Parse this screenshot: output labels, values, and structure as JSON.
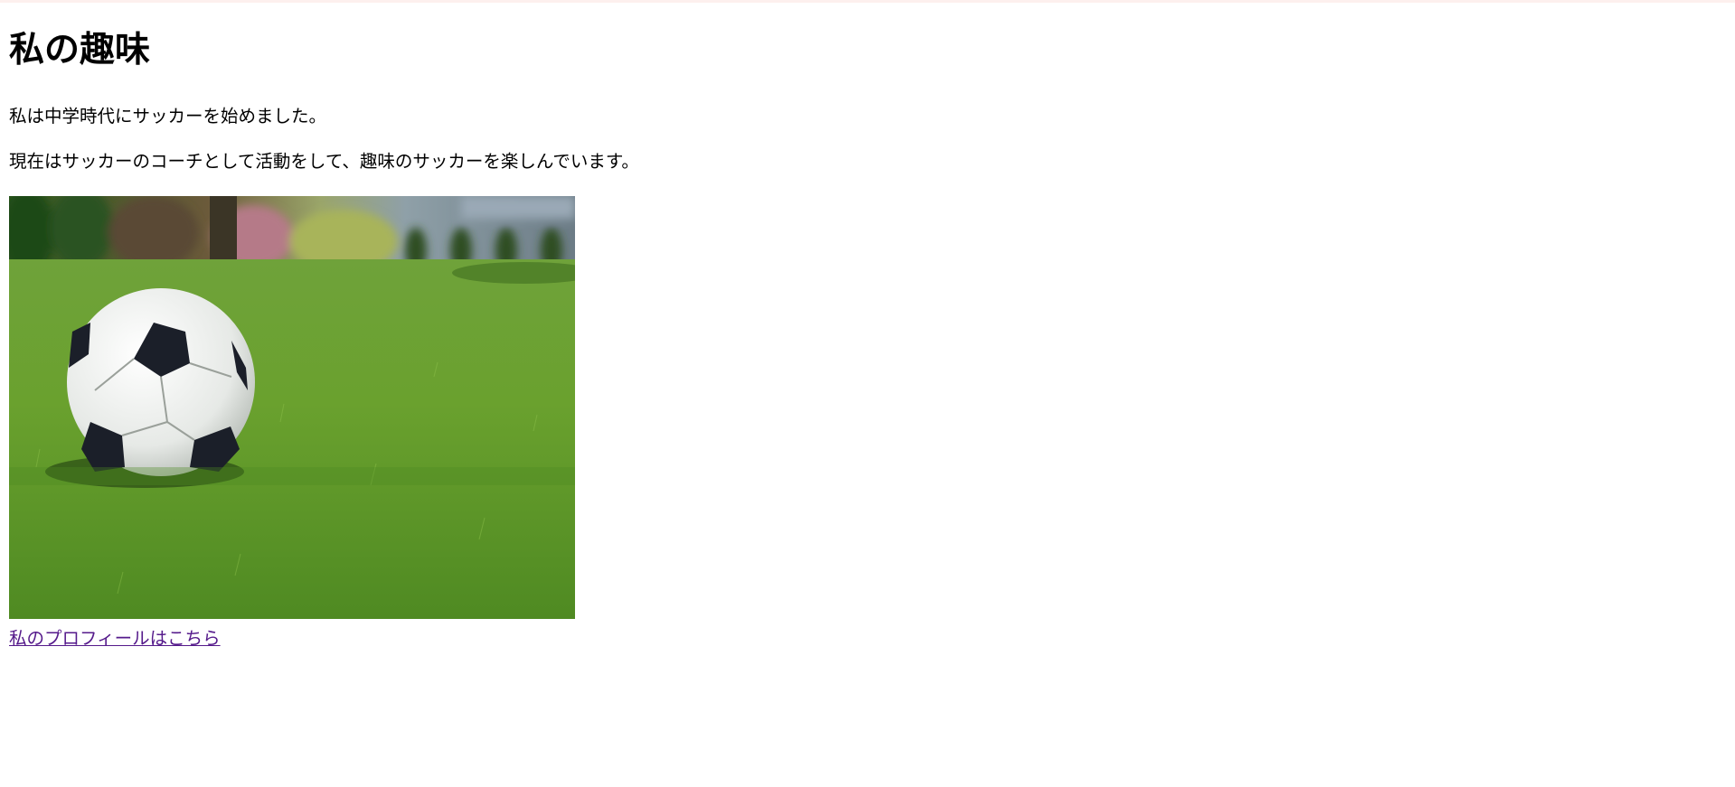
{
  "page": {
    "heading": "私の趣味",
    "paragraphs": [
      "私は中学時代にサッカーを始めました。",
      "現在はサッカーのコーチとして活動をして、趣味のサッカーを楽しんでいます。"
    ],
    "image_alt": "soccer-ball-on-grass",
    "link_text": "私のプロフィールはこちら"
  },
  "colors": {
    "link_visited": "#551a8b",
    "grass": "#5f9a2c",
    "top_rule": "#fdf0ee"
  }
}
